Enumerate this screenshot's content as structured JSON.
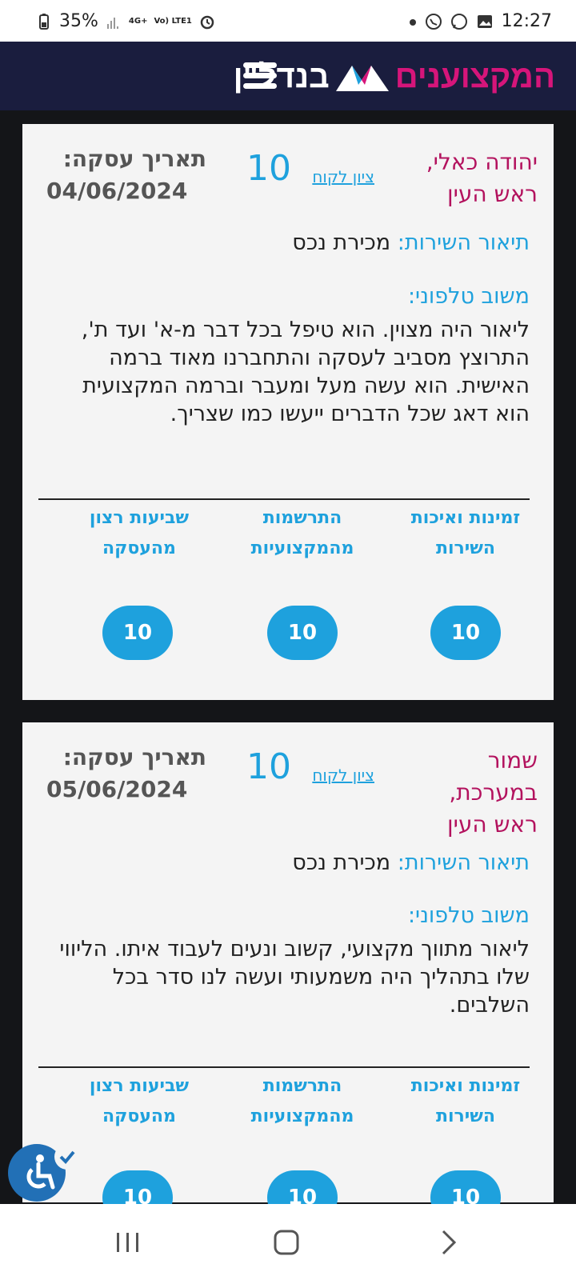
{
  "status_bar": {
    "battery": "35%",
    "network_top": "4G+",
    "network_label": "Vo) LTE1",
    "time": "12:27"
  },
  "header": {
    "logo_primary": "בנדל\"ן",
    "logo_secondary": "המקצוענים",
    "menu_icon": "hamburger-icon"
  },
  "reviews": [
    {
      "name": "יהודה כאלי, ראש העין",
      "score_link": "ציון לקוח",
      "score": "10",
      "date_label": "תאריך עסקה:",
      "date": "04/06/2024",
      "service_label": "תיאור השירות:",
      "service": "מכירת נכס",
      "feedback_label": "משוב טלפוני:",
      "feedback": "ליאור היה מצוין. הוא טיפל בכל דבר מ-א' ועד ת', התרוצץ מסביב לעסקה והתחברנו מאוד ברמה האישית. הוא עשה מעל ומעבר וברמה המקצועית הוא דאג שכל הדברים ייעשו כמו שצריך.",
      "categories": [
        {
          "label": "זמינות ואיכות השירות",
          "score": "10"
        },
        {
          "label": "התרשמות מהמקצועיות",
          "score": "10"
        },
        {
          "label": "שביעות רצון מהעסקה",
          "score": "10"
        }
      ]
    },
    {
      "name": "שמור במערכת, ראש העין",
      "score_link": "ציון לקוח",
      "score": "10",
      "date_label": "תאריך עסקה:",
      "date": "05/06/2024",
      "service_label": "תיאור השירות:",
      "service": "מכירת נכס",
      "feedback_label": "משוב טלפוני:",
      "feedback": "ליאור מתווך מקצועי, קשוב ונעים לעבוד איתו. הליווי שלו בתהליך היה משמעותי ועשה לנו סדר בכל השלבים.",
      "categories": [
        {
          "label": "זמינות ואיכות השירות",
          "score": "10"
        },
        {
          "label": "התרשמות מהמקצועיות",
          "score": "10"
        },
        {
          "label": "שביעות רצון מהעסקה",
          "score": "10"
        }
      ]
    }
  ],
  "colors": {
    "header_bg": "#1a1d3e",
    "accent_blue": "#1ea1dd",
    "name_magenta": "#b3125e",
    "card_bg": "#f4f4f4"
  }
}
